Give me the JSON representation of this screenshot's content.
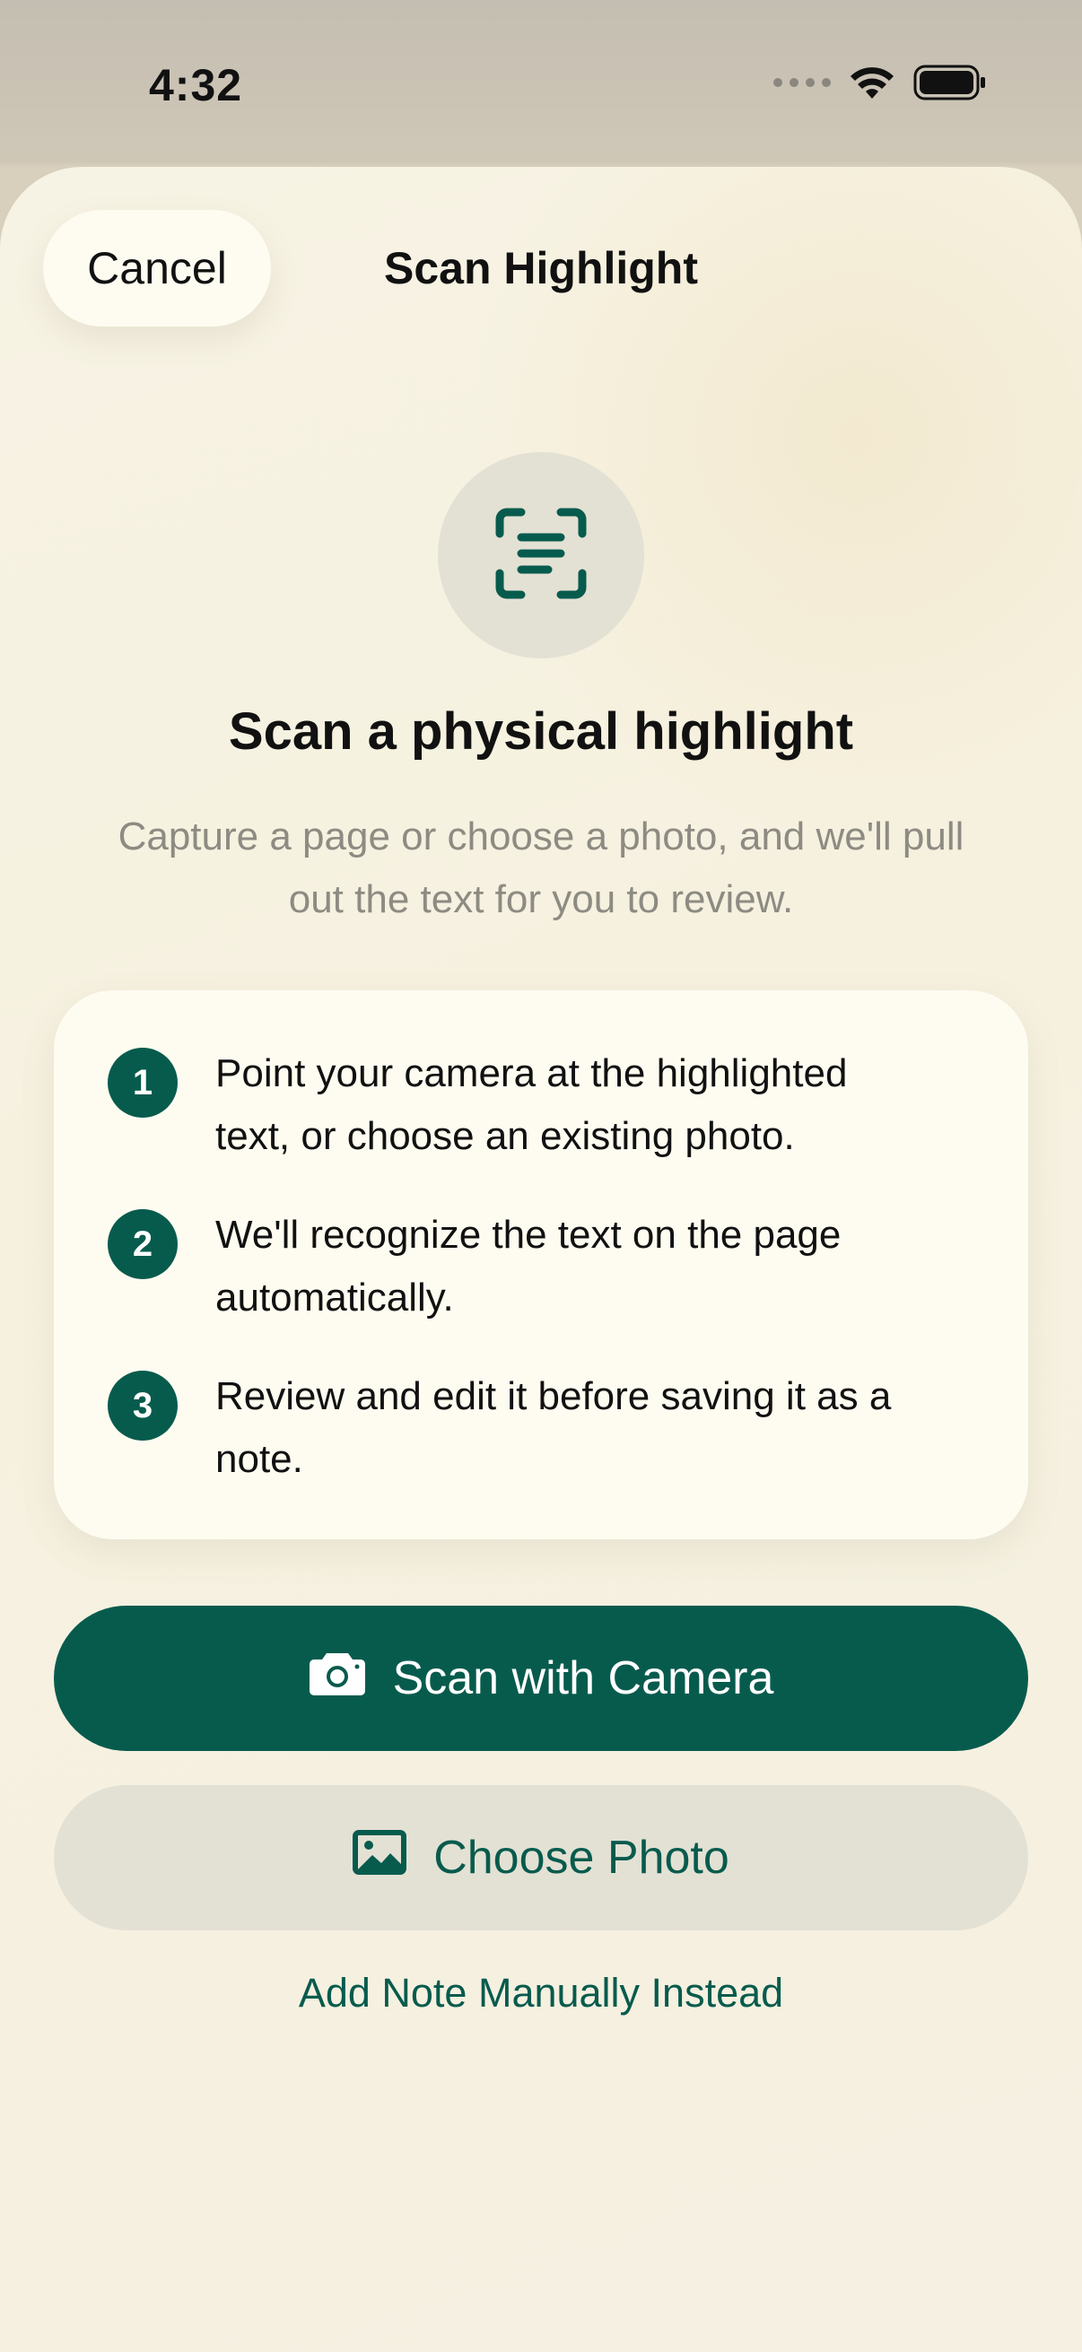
{
  "status_bar": {
    "time": "4:32"
  },
  "nav": {
    "cancel_label": "Cancel",
    "title": "Scan Highlight"
  },
  "hero": {
    "icon": "document-scanner-icon",
    "title": "Scan a physical highlight",
    "subtitle": "Capture a page or choose a photo, and we'll pull out the text for you to review."
  },
  "steps": [
    {
      "number": "1",
      "text": "Point your camera at the highlighted text, or choose an existing photo."
    },
    {
      "number": "2",
      "text": "We'll recognize the text on the page automatically."
    },
    {
      "number": "3",
      "text": "Review and edit it before saving it as a note."
    }
  ],
  "actions": {
    "scan_camera_label": "Scan with Camera",
    "choose_photo_label": "Choose Photo",
    "manual_label": "Add Note Manually Instead"
  },
  "colors": {
    "accent": "#075b4d",
    "secondary_button": "#e3e1d4",
    "card": "#fefcf0",
    "subtitle": "#8d8b82"
  }
}
